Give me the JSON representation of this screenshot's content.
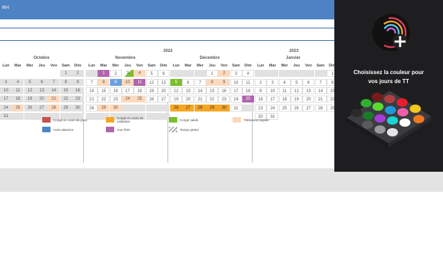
{
  "header": {
    "title": "RH"
  },
  "calendar": {
    "year_2022": "2022",
    "year_2023": "2023",
    "months": {
      "octobre": "Octobre",
      "novembre": "Novembre",
      "decembre": "Décembre",
      "janvier": "Janvier"
    },
    "weekdays": [
      "Lun",
      "Mar",
      "Mer",
      "Jeu",
      "Ven",
      "Sam",
      "Dim"
    ]
  },
  "legend": {
    "items": [
      {
        "label": "Congé en cours de pose",
        "color": "#c9504a"
      },
      {
        "label": "Congé en cours de validation",
        "color": "#f5a623"
      },
      {
        "label": "Congé validé",
        "color": "#7cbd2d"
      },
      {
        "label": "Télétravail régulier",
        "color": "#fcd9bd"
      },
      {
        "label": "Autre absence",
        "color": "#4a86c8"
      },
      {
        "label": "Jour férié",
        "color": "#b064ac"
      },
      {
        "label": "Temps partiel",
        "color": "#aaaaaa"
      }
    ]
  },
  "promo": {
    "line1": "Choisissez la couleur pour",
    "line2": "vos jours de TT"
  }
}
